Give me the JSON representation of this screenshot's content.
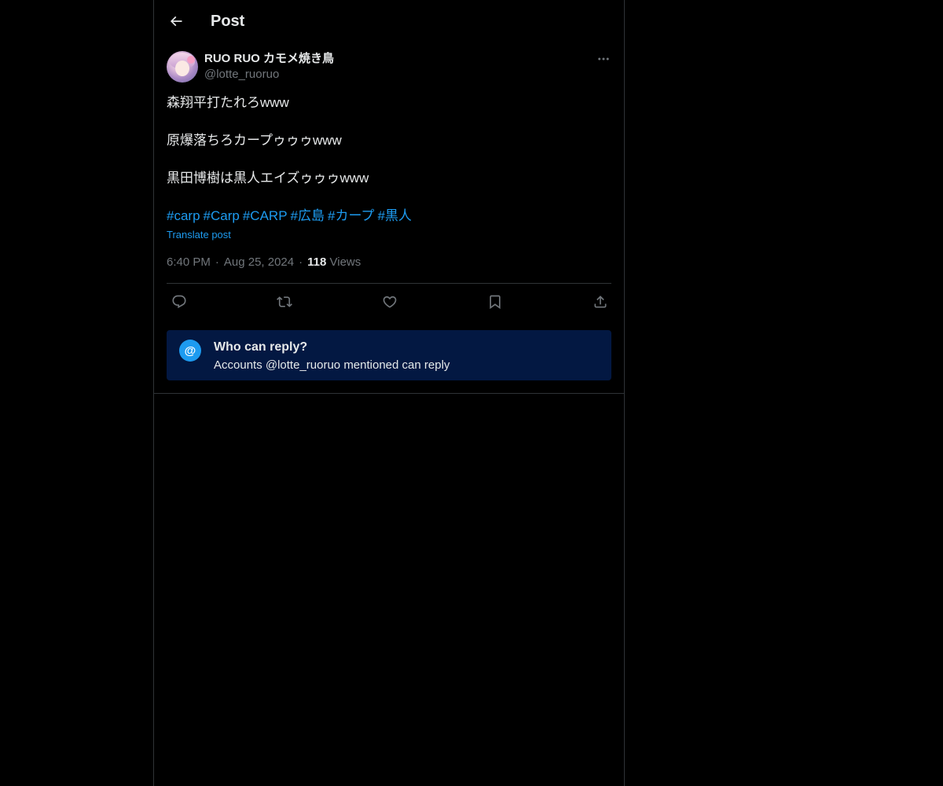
{
  "header": {
    "title": "Post",
    "back_icon": "arrow-left-icon"
  },
  "author": {
    "display_name": "RUO RUO カモメ焼き鳥",
    "handle": "@lotte_ruoruo",
    "avatar_icon": "avatar-image"
  },
  "post": {
    "lines": [
      "森翔平打たれろwww",
      "原爆落ちろカープゥゥゥwww",
      "黒田博樹は黒人エイズゥゥゥwww"
    ],
    "hashtags": [
      "#carp",
      "#Carp",
      "#CARP",
      "#広島",
      "#カープ",
      "#黒人"
    ],
    "translate_label": "Translate post"
  },
  "meta": {
    "time": "6:40 PM",
    "date": "Aug 25, 2024",
    "views_count": "118",
    "views_label": "Views",
    "separator": "·"
  },
  "actions": [
    "reply-icon",
    "repost-icon",
    "like-icon",
    "bookmark-icon",
    "share-icon"
  ],
  "reply_restriction": {
    "icon_text": "@",
    "title": "Who can reply?",
    "subtitle": "Accounts @lotte_ruoruo mentioned can reply"
  },
  "colors": {
    "background": "#000000",
    "text": "#e7e9ea",
    "muted": "#71767b",
    "accent": "#1d9bf0",
    "border": "#2f3336",
    "reply_box": "#031842"
  }
}
